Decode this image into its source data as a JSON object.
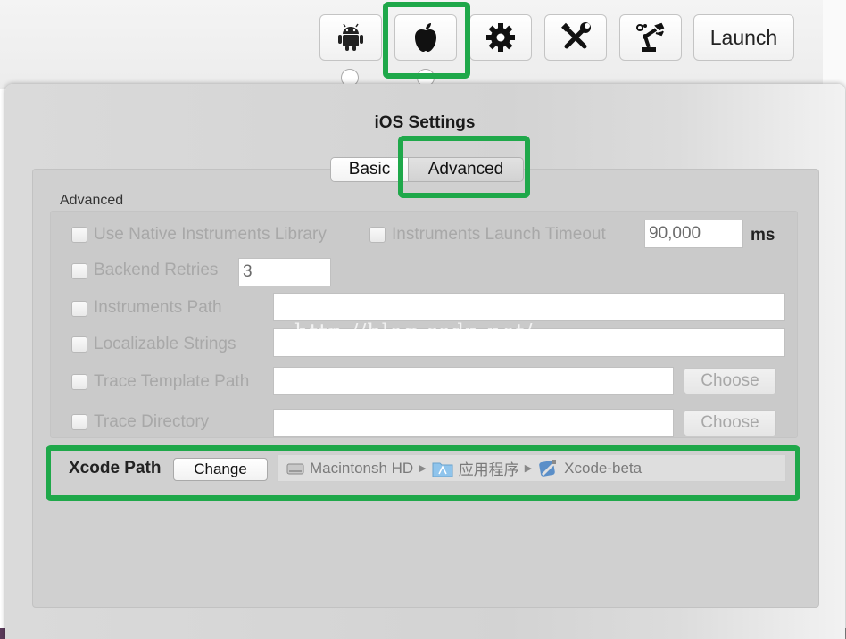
{
  "toolbar": {
    "buttons": [
      {
        "name": "android",
        "icon": "android-icon"
      },
      {
        "name": "apple",
        "icon": "apple-icon"
      },
      {
        "name": "settings",
        "icon": "gear-icon"
      },
      {
        "name": "tools",
        "icon": "wrench-screwdriver-icon"
      },
      {
        "name": "robot-arm",
        "icon": "robot-arm-icon"
      }
    ],
    "launch_label": "Launch"
  },
  "sheet": {
    "title": "iOS Settings",
    "tabs": [
      {
        "label": "Basic",
        "selected": false
      },
      {
        "label": "Advanced",
        "selected": true
      }
    ],
    "group_label": "Advanced",
    "rows": {
      "native_instruments": "Use Native Instruments Library",
      "launch_timeout": "Instruments Launch Timeout",
      "launch_timeout_value": "90,000",
      "launch_timeout_unit": "ms",
      "backend_retries": "Backend Retries",
      "backend_retries_value": "3",
      "instruments_path": "Instruments Path",
      "localizable_strings": "Localizable Strings",
      "trace_template_path": "Trace Template Path",
      "trace_directory": "Trace Directory",
      "choose_label": "Choose"
    },
    "xcode": {
      "label": "Xcode Path",
      "change_label": "Change",
      "path": [
        "Macintonsh HD",
        "应用程序",
        "Xcode-beta"
      ]
    },
    "watermark": "http://blog.csdn.net/"
  },
  "colors": {
    "highlight": "#1fa84a",
    "sheet_bg": "#d3d3d3"
  }
}
